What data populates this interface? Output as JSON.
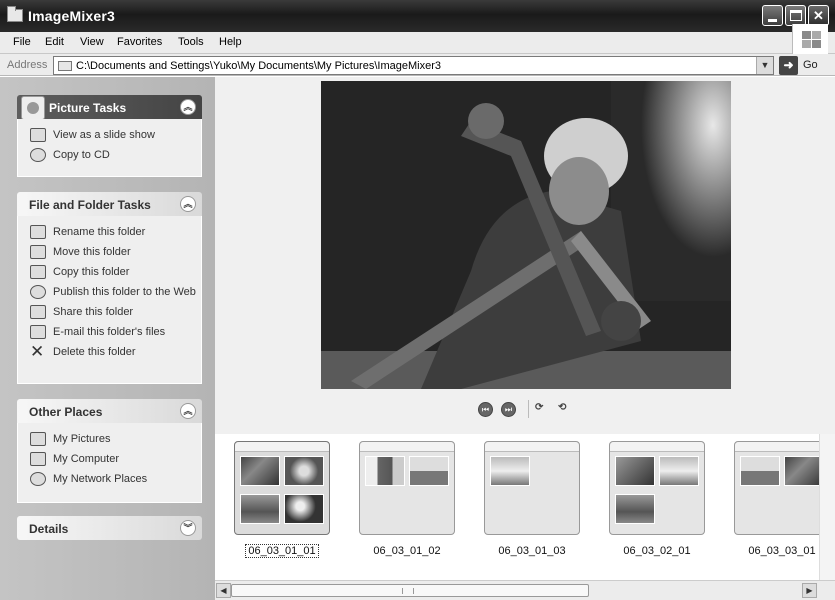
{
  "window": {
    "title": "ImageMixer3",
    "minimize_icon": "minimize-icon",
    "maximize_icon": "maximize-icon",
    "close_label": "✕"
  },
  "menu": {
    "items": [
      "File",
      "Edit",
      "View",
      "Favorites",
      "Tools",
      "Help"
    ]
  },
  "address": {
    "label": "Address",
    "path": "C:\\Documents and Settings\\Yuko\\My Documents\\My Pictures\\ImageMixer3",
    "go_label": "Go"
  },
  "picture_tasks": {
    "title": "Picture Tasks",
    "items": [
      "View as a slide show",
      "Copy to CD"
    ]
  },
  "file_folder_tasks": {
    "title": "File and Folder Tasks",
    "items": [
      "Rename this folder",
      "Move this folder",
      "Copy this folder",
      "Publish this folder to the Web",
      "Share this folder",
      "E-mail this folder's files",
      "Delete this folder"
    ]
  },
  "other_places": {
    "title": "Other Places",
    "items": [
      "My Pictures",
      "My Computer",
      "My Network Places"
    ]
  },
  "details": {
    "title": "Details"
  },
  "thumbnails": [
    {
      "label": "06_03_01_01",
      "selected": true
    },
    {
      "label": "06_03_01_02",
      "selected": false
    },
    {
      "label": "06_03_01_03",
      "selected": false
    },
    {
      "label": "06_03_02_01",
      "selected": false
    },
    {
      "label": "06_03_03_01",
      "selected": false
    }
  ],
  "colors": {
    "titlebar": "#2a2a2a",
    "left_pane": "#bdbdbd",
    "panel_body": "#efefef"
  }
}
